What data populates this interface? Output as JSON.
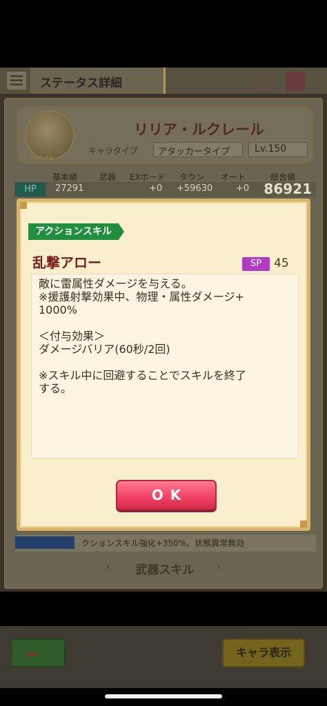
{
  "header": {
    "title": "ステータス詳細"
  },
  "character": {
    "name": "リリア・ルクレール",
    "type_label": "キャラタイプ",
    "type_value": "アタッカータイプ",
    "level": "Lv.150",
    "stars": "★★★★★"
  },
  "stats": {
    "columns": [
      "基本値",
      "武器",
      "EXボード",
      "タウン",
      "オート",
      "総合値"
    ],
    "hp_label": "HP",
    "hp_values": [
      "27291",
      "+0",
      "+59630",
      "+0"
    ],
    "hp_total": "86921"
  },
  "skill_strip": {
    "text": "クションスキル強化+350%、状態異常無効"
  },
  "weapon_section": {
    "title": "武器スキル",
    "left_arrow": "‹",
    "right_arrow": "›"
  },
  "footer": {
    "back_icon": "left-arrow-icon",
    "chara_button": "キャラ表示"
  },
  "dialog": {
    "category": "アクションスキル",
    "skill_name": "乱撃アロー",
    "sp_label": "SP",
    "sp_value": "45",
    "description": {
      "line1": "敵に雷属性ダメージを与える。",
      "line2": "※援護射撃効果中、物理・属性ダメージ+",
      "line3": "1000%",
      "line4": "＜付与効果＞",
      "line5": "ダメージバリア(60秒/2回)",
      "line6": "※スキル中に回避することでスキルを終了",
      "line7": "する。"
    },
    "ok_label": "OK"
  },
  "colors": {
    "ribbon": "#1f8f3e",
    "skill_name": "#7a1f1f",
    "sp_badge": "#b33ac6",
    "ok_button": "#f24466",
    "dialog_bg": "#faefcc",
    "dialog_border": "#d8b56a"
  }
}
